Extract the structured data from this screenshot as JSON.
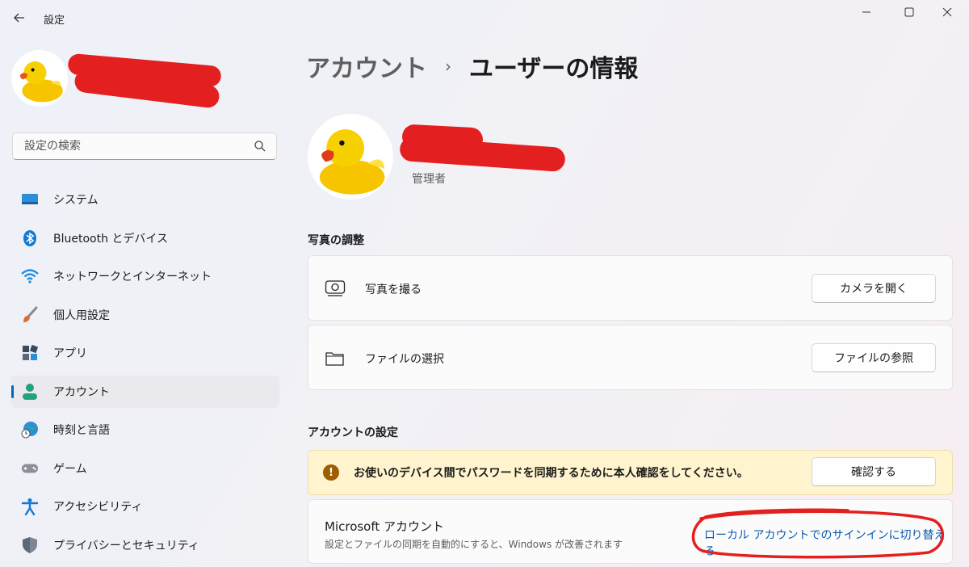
{
  "window": {
    "title": "設定"
  },
  "sidebar": {
    "search": {
      "placeholder": "設定の検索"
    },
    "items": [
      {
        "label": "システム",
        "icon": "system-icon"
      },
      {
        "label": "Bluetooth とデバイス",
        "icon": "bluetooth-icon"
      },
      {
        "label": "ネットワークとインターネット",
        "icon": "wifi-icon"
      },
      {
        "label": "個人用設定",
        "icon": "brush-icon"
      },
      {
        "label": "アプリ",
        "icon": "apps-icon"
      },
      {
        "label": "アカウント",
        "icon": "account-icon",
        "active": true
      },
      {
        "label": "時刻と言語",
        "icon": "globe-clock-icon"
      },
      {
        "label": "ゲーム",
        "icon": "gamepad-icon"
      },
      {
        "label": "アクセシビリティ",
        "icon": "accessibility-icon"
      },
      {
        "label": "プライバシーとセキュリティ",
        "icon": "shield-icon"
      }
    ]
  },
  "main": {
    "breadcrumb": {
      "parent": "アカウント",
      "separator": "›",
      "current": "ユーザーの情報"
    },
    "user": {
      "role": "管理者"
    },
    "photo_section": {
      "title": "写真の調整",
      "rows": [
        {
          "label": "写真を撮る",
          "button": "カメラを開く",
          "icon": "camera-icon"
        },
        {
          "label": "ファイルの選択",
          "button": "ファイルの参照",
          "icon": "folder-icon"
        }
      ]
    },
    "account_section": {
      "title": "アカウントの設定",
      "warning": {
        "text": "お使いのデバイス間でパスワードを同期するために本人確認をしてください。",
        "button": "確認する"
      },
      "microsoft": {
        "title": "Microsoft アカウント",
        "subtitle": "設定とファイルの同期を自動的にすると、Windows が改善されます",
        "link": "ローカル アカウントでのサインインに切り替える"
      }
    }
  },
  "colors": {
    "accent": "#0067c0",
    "link": "#0a5cb0",
    "warning_bg": "#fff4ce",
    "annotation": "#e3201f"
  }
}
